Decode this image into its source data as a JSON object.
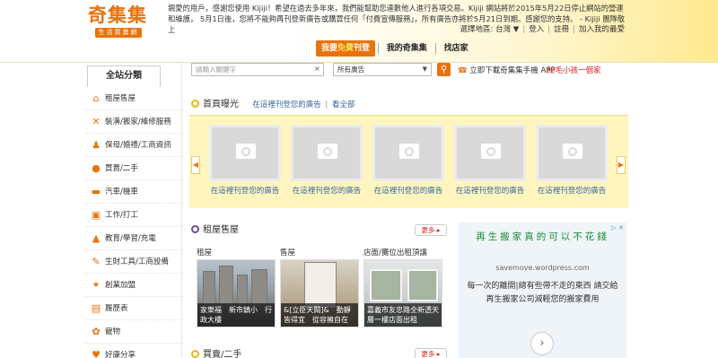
{
  "header": {
    "logo_main": "奇集集",
    "logo_sub": "生活買賣網",
    "notice": "親愛的用戶，感謝您使用 Kijiji！希望在過去多年來，我們能幫助您達數他人進行各項交易。Kijiji 網站將於2015年5月22日停止網站的營運和維護， 5月1日後，您將不能夠再刊登新廣告或購買任何「付費宣傳服務」，所有廣告亦將於5月21日到期。感謝您的支持。 - Kijiji 團隊敬上",
    "region_label": "選擇地區: 台灣 ▼",
    "login": "登入",
    "register": "註冊",
    "favorites": "加入我的最愛",
    "tabs": {
      "free_post_pre": "我要",
      "free_post_hl": "免費",
      "free_post_post": "刊登",
      "my_kijiji": "我的奇集集",
      "find_shop": "找店家"
    }
  },
  "search": {
    "placeholder": "請輸入關鍵字",
    "clear": "×",
    "category": "所有廣告",
    "button_icon": "search-icon",
    "app_link": "立即下載奇集集手機 APP",
    "tip_link": "紛毛小孩一個家"
  },
  "sidebar": {
    "title": "全站分類",
    "items": [
      {
        "label": "租屋售屋",
        "icon": "house-icon"
      },
      {
        "label": "裝潢/搬家/維修服務",
        "icon": "tools-icon"
      },
      {
        "label": "保母/婚禮/工商資訊",
        "icon": "person-icon"
      },
      {
        "label": "買賣/二手",
        "icon": "people-icon"
      },
      {
        "label": "汽車/機車",
        "icon": "car-icon"
      },
      {
        "label": "工作/打工",
        "icon": "briefcase-icon"
      },
      {
        "label": "教育/學習/充電",
        "icon": "graduation-icon"
      },
      {
        "label": "生財工具/工商設備",
        "icon": "tool-icon"
      },
      {
        "label": "創業加盟",
        "icon": "handshake-icon"
      },
      {
        "label": "履歷表",
        "icon": "resume-icon"
      },
      {
        "label": "寵物",
        "icon": "paw-icon"
      },
      {
        "label": "好康分享",
        "icon": "heart-icon"
      }
    ]
  },
  "exposure": {
    "title": "首頁曝光",
    "post_here": "在這裡刊登您的廣告",
    "pipe": "|",
    "view_all": "看全部",
    "cards": [
      {
        "caption": "在這裡刊登您的廣告"
      },
      {
        "caption": "在這裡刊登您的廣告"
      },
      {
        "caption": "在這裡刊登您的廣告"
      },
      {
        "caption": "在這裡刊登您的廣告"
      },
      {
        "caption": "在這裡刊登您的廣告"
      }
    ]
  },
  "rental": {
    "title": "租屋售屋",
    "more": "更多 ▸",
    "columns": [
      {
        "title": "租屋",
        "caption": "家樂福　新市鎮小　行政大樓"
      },
      {
        "title": "售屋",
        "caption": "&[立臣天闕]&　動靜皆得宜　從容擁自在"
      },
      {
        "title": "店面/攤位出租頂讓",
        "caption": "嘉義市友忠路全新透天層一樓店面出租"
      }
    ]
  },
  "secondhand": {
    "title": "買賣/二手",
    "more": "更多 ▸"
  },
  "ad": {
    "title": "再生搬家真的可以不花錢",
    "url": "savemove.wordpress.com",
    "body": "每一次的離開|總有些帶不走的東西 請交給再生搬家公司減輕您的搬家費用",
    "next": "›"
  },
  "colors": {
    "accent": "#e8730e",
    "link": "#336699",
    "exposure_bg": "#fff6bf",
    "ad_title": "#1d8a3a"
  }
}
